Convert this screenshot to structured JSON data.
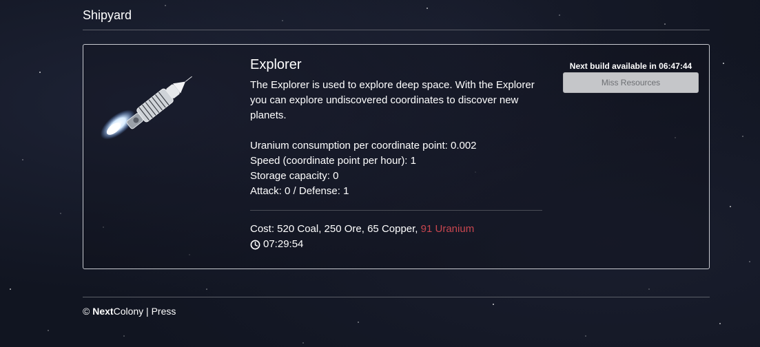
{
  "header": {
    "title": "Shipyard"
  },
  "ship": {
    "name": "Explorer",
    "description": "The Explorer is used to explore deep space. With the Explorer you can explore undiscovered coordinates to discover new planets.",
    "stats": [
      "Uranium consumption per coordinate point: 0.002",
      "Speed (coordinate point per hour): 1",
      "Storage capacity: 0",
      "Attack: 0 / Defense: 1"
    ],
    "cost_prefix": "Cost: 520 Coal, 250 Ore, 65 Copper, ",
    "cost_missing": "91 Uranium",
    "build_time": "07:29:54",
    "icon": "rocket-ship-image"
  },
  "build": {
    "next_label": "Next build available in 06:47:44",
    "button_label": "Miss Resources"
  },
  "footer": {
    "copyright": "© ",
    "brand_bold": "Next",
    "brand_rest": "Colony",
    "separator": " | ",
    "press": "Press"
  },
  "colors": {
    "missing_resource": "#c9464f",
    "button_bg": "#c5c6c9"
  }
}
